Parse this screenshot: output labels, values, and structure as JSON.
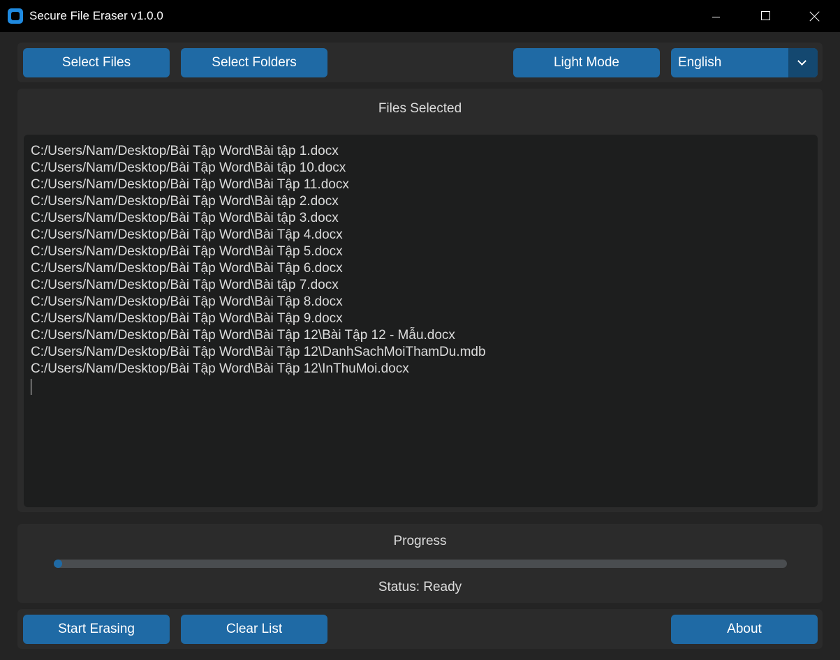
{
  "window": {
    "title": "Secure File Eraser v1.0.0"
  },
  "toolbar": {
    "select_files": "Select Files",
    "select_folders": "Select Folders",
    "theme_toggle": "Light Mode",
    "language": {
      "selected": "English"
    }
  },
  "files_panel": {
    "title": "Files Selected",
    "files": [
      "C:/Users/Nam/Desktop/Bài Tập Word\\Bài tập 1.docx",
      "C:/Users/Nam/Desktop/Bài Tập Word\\Bài tập 10.docx",
      "C:/Users/Nam/Desktop/Bài Tập Word\\Bài Tập 11.docx",
      "C:/Users/Nam/Desktop/Bài Tập Word\\Bài tập 2.docx",
      "C:/Users/Nam/Desktop/Bài Tập Word\\Bài tập 3.docx",
      "C:/Users/Nam/Desktop/Bài Tập Word\\Bài Tập 4.docx",
      "C:/Users/Nam/Desktop/Bài Tập Word\\Bài Tập 5.docx",
      "C:/Users/Nam/Desktop/Bài Tập Word\\Bài Tập 6.docx",
      "C:/Users/Nam/Desktop/Bài Tập Word\\Bài tập 7.docx",
      "C:/Users/Nam/Desktop/Bài Tập Word\\Bài Tập 8.docx",
      "C:/Users/Nam/Desktop/Bài Tập Word\\Bài Tập 9.docx",
      "C:/Users/Nam/Desktop/Bài Tập Word\\Bài Tập 12\\Bài Tập 12 - Mẫu.docx",
      "C:/Users/Nam/Desktop/Bài Tập Word\\Bài Tập 12\\DanhSachMoiThamDu.mdb",
      "C:/Users/Nam/Desktop/Bài Tập Word\\Bài Tập 12\\InThuMoi.docx"
    ]
  },
  "progress_panel": {
    "title": "Progress",
    "value_percent": 0,
    "status": "Status: Ready"
  },
  "actions": {
    "start": "Start Erasing",
    "clear": "Clear List",
    "about": "About"
  },
  "colors": {
    "accent": "#1f6aa5",
    "background": "#242424",
    "panel": "#2b2b2b",
    "textbox": "#1d1e1e"
  },
  "icons": {
    "app": "app-logo-icon",
    "minimize": "minimize-icon",
    "maximize": "maximize-icon",
    "close": "close-icon",
    "dropdown": "chevron-down-icon"
  }
}
